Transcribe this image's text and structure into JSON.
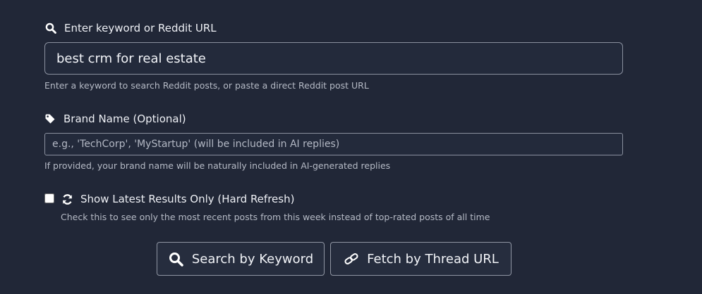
{
  "keyword": {
    "label": "Enter keyword or Reddit URL",
    "value": "best crm for real estate",
    "help": "Enter a keyword to search Reddit posts, or paste a direct Reddit post URL",
    "icon": "search-icon"
  },
  "brand": {
    "label": "Brand Name (Optional)",
    "value": "",
    "placeholder": "e.g., 'TechCorp', 'MyStartup' (will be included in AI replies)",
    "help": "If provided, your brand name will be naturally included in AI-generated replies",
    "icon": "tag-icon"
  },
  "latest": {
    "label": "Show Latest Results Only (Hard Refresh)",
    "help": "Check this to see only the most recent posts from this week instead of top-rated posts of all time",
    "checked": false,
    "icon": "refresh-icon"
  },
  "actions": {
    "search_label": "Search by Keyword",
    "fetch_label": "Fetch by Thread URL"
  },
  "colors": {
    "background": "#212737",
    "border": "#8a909e",
    "text": "#eef0f5",
    "muted_text": "#b5bac5"
  }
}
